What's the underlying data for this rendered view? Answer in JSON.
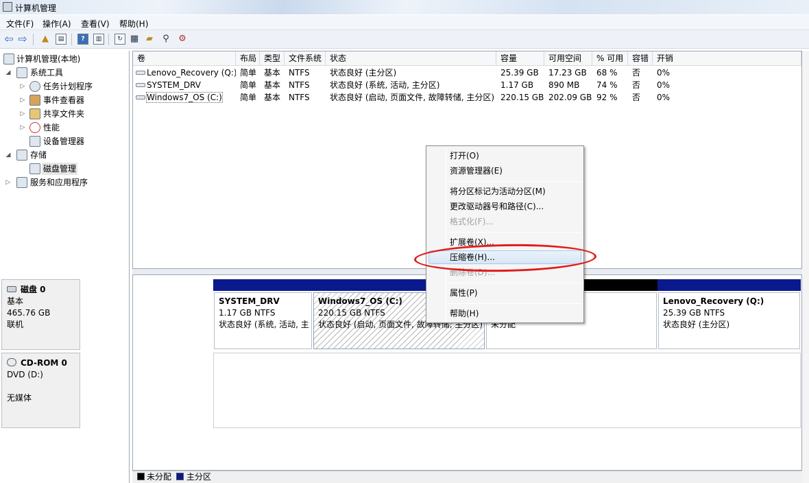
{
  "window": {
    "title": "计算机管理"
  },
  "menubar": {
    "items": [
      "文件(F)",
      "操作(A)",
      "查看(V)",
      "帮助(H)"
    ]
  },
  "toolbar": {
    "icons": [
      "back-arrow-icon",
      "forward-arrow-icon",
      "up-folder-icon",
      "show-hide-tree-icon",
      "help-icon",
      "show-hide-action-pane-icon",
      "refresh-icon",
      "properties-icon",
      "open-folder-icon",
      "search-icon",
      "settings-icon"
    ]
  },
  "sidebar": {
    "root": "计算机管理(本地)",
    "items": [
      {
        "label": "系统工具",
        "level": 1,
        "expanded": true
      },
      {
        "label": "任务计划程序",
        "level": 2,
        "expanded": false
      },
      {
        "label": "事件查看器",
        "level": 2,
        "expanded": false
      },
      {
        "label": "共享文件夹",
        "level": 2,
        "expanded": false
      },
      {
        "label": "性能",
        "level": 2,
        "expanded": false
      },
      {
        "label": "设备管理器",
        "level": 2
      },
      {
        "label": "存储",
        "level": 1,
        "expanded": true
      },
      {
        "label": "磁盘管理",
        "level": 2,
        "selected": true
      },
      {
        "label": "服务和应用程序",
        "level": 1,
        "expanded": false
      }
    ]
  },
  "volumes": {
    "columns": [
      "卷",
      "布局",
      "类型",
      "文件系统",
      "状态",
      "容量",
      "可用空间",
      "% 可用",
      "容错",
      "开销"
    ],
    "rows": [
      [
        "Lenovo_Recovery (Q:)",
        "简单",
        "基本",
        "NTFS",
        "状态良好 (主分区)",
        "25.39 GB",
        "17.23 GB",
        "68 %",
        "否",
        "0%"
      ],
      [
        "SYSTEM_DRV",
        "简单",
        "基本",
        "NTFS",
        "状态良好 (系统, 活动, 主分区)",
        "1.17 GB",
        "890 MB",
        "74 %",
        "否",
        "0%"
      ],
      [
        "Windows7_OS (C:)",
        "简单",
        "基本",
        "NTFS",
        "状态良好 (启动, 页面文件, 故障转储, 主分区)",
        "220.15 GB",
        "202.09 GB",
        "92 %",
        "否",
        "0%"
      ]
    ]
  },
  "disks": {
    "disk0": {
      "name": "磁盘 0",
      "type": "基本",
      "size": "465.76 GB",
      "status": "联机"
    },
    "cdrom0": {
      "name": "CD-ROM 0",
      "type": "DVD (D:)",
      "status": "无媒体"
    },
    "partitions": [
      {
        "name": "SYSTEM_DRV",
        "size": "1.17 GB NTFS",
        "status": "状态良好 (系统, 活动, 主"
      },
      {
        "name": "Windows7_OS  (C:)",
        "size": "220.15 GB NTFS",
        "status": "状态良好 (启动, 页面文件, 故障转储, 主分区)"
      },
      {
        "name": "",
        "size": "",
        "status": "未分配"
      },
      {
        "name": "Lenovo_Recovery  (Q:)",
        "size": "25.39 GB NTFS",
        "status": "状态良好 (主分区)"
      }
    ]
  },
  "legend": {
    "unallocated": "未分配",
    "primary": "主分区"
  },
  "context_menu": {
    "items": [
      {
        "label": "打开(O)",
        "enabled": true
      },
      {
        "label": "资源管理器(E)",
        "enabled": true
      },
      {
        "label": "将分区标记为活动分区(M)",
        "enabled": true
      },
      {
        "label": "更改驱动器号和路径(C)...",
        "enabled": true
      },
      {
        "label": "格式化(F)...",
        "enabled": false
      },
      {
        "label": "扩展卷(X)...",
        "enabled": true
      },
      {
        "label": "压缩卷(H)...",
        "enabled": true,
        "highlighted": true
      },
      {
        "label": "删除卷(D)...",
        "enabled": false
      },
      {
        "label": "属性(P)",
        "enabled": true
      },
      {
        "label": "帮助(H)",
        "enabled": true
      }
    ]
  },
  "colors": {
    "primary_partition": "#0a1a8c",
    "unallocated": "#000000",
    "annotation": "#e21b1b"
  }
}
